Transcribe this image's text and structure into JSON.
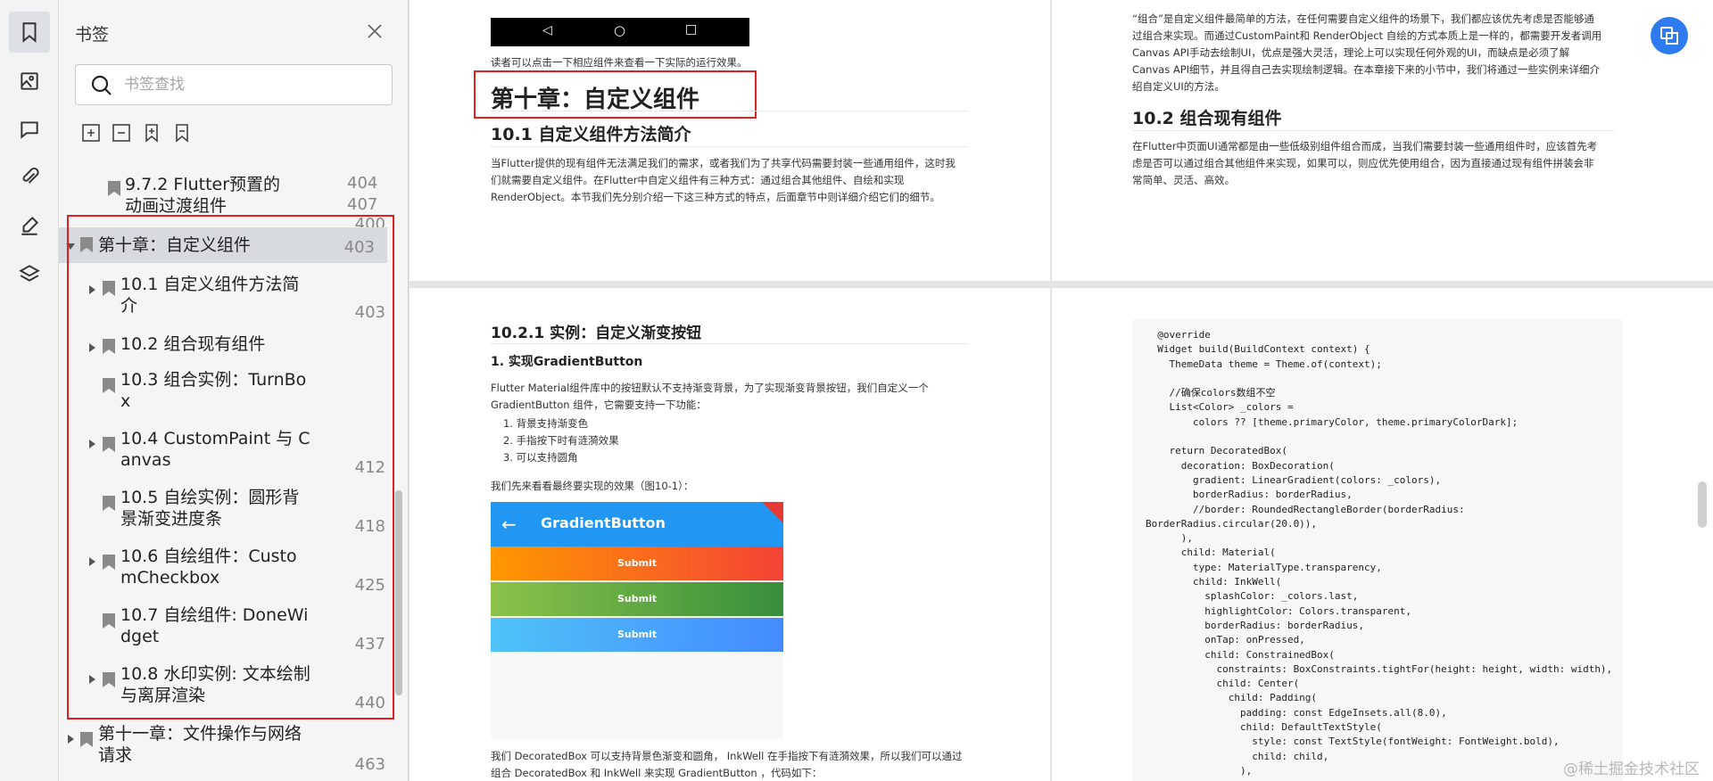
{
  "rail": {
    "icons": [
      "bookmark-icon",
      "image-icon",
      "comment-icon",
      "attachment-icon",
      "pen-icon",
      "layers-icon"
    ]
  },
  "panel": {
    "title": "书签",
    "search_placeholder": "书签查找",
    "tree": [
      {
        "label_lines": [
          "9.7.2 Flutter预置的",
          "动画过渡组件"
        ],
        "page": "400"
      },
      {
        "label_lines": [
          "第十章：自定义组件"
        ],
        "page": "403"
      },
      {
        "label_lines": [
          "10.1 自定义组件方法简",
          "介"
        ],
        "page": "403"
      },
      {
        "label_lines": [
          "10.2 组合现有组件"
        ],
        "page": "404"
      },
      {
        "label_lines": [
          "10.3 组合实例：TurnBo",
          "x"
        ],
        "page": "407"
      },
      {
        "label_lines": [
          "10.4 CustomPaint 与 C",
          "anvas"
        ],
        "page": "412"
      },
      {
        "label_lines": [
          "10.5 自绘实例：圆形背",
          "景渐变进度条"
        ],
        "page": "418"
      },
      {
        "label_lines": [
          "10.6 自绘组件：Custo",
          "mCheckbox"
        ],
        "page": "425"
      },
      {
        "label_lines": [
          "10.7 自绘组件: DoneWi",
          "dget"
        ],
        "page": "437"
      },
      {
        "label_lines": [
          "10.8 水印实例: 文本绘制",
          "与离屏渲染"
        ],
        "page": "440"
      },
      {
        "label_lines": [
          "第十一章：文件操作与网络",
          "请求"
        ],
        "page": "463"
      }
    ]
  },
  "doc": {
    "p1": {
      "caption": "读者可以点击一下相应组件来查看一下实际的运行效果。",
      "chapter_title": "第十章：自定义组件",
      "sec_title": "10.1 自定义组件方法简介",
      "para": [
        "当Flutter提供的现有组件无法满足我们的需求，或者我们为了共享代码需要封装一些通用组件，这时我",
        "们就需要自定义组件。在Flutter中自定义组件有三种方式：通过组合其他组件、自绘和实现",
        "RenderObject。本节我们先分别介绍一下这三种方式的特点，后面章节中则详细介绍它们的细节。"
      ]
    },
    "p2": {
      "para1": [
        "“组合”是自定义组件最简单的方法，在任何需要自定义组件的场景下，我们都应该优先考虑是否能够通",
        "过组合来实现。而通过CustomPaint和 RenderObject 自绘的方式本质上是一样的，都需要开发者调用",
        "Canvas API手动去绘制UI，优点是强大灵活，理论上可以实现任何外观的UI，而缺点是必须了解",
        "Canvas API细节，并且得自己去实现绘制逻辑。在本章接下来的小节中，我们将通过一些实例来详细介",
        "绍自定义UI的方法。"
      ],
      "sec_title": "10.2 组合现有组件",
      "para2": [
        "在Flutter中页面UI通常都是由一些低级别组件组合而成，当我们需要封装一些通用组件时，应该首先考",
        "虑是否可以通过组合其他组件来实现，如果可以，则应优先使用组合，因为直接通过现有组件拼装会非",
        "常简单、灵活、高效。"
      ]
    },
    "p3": {
      "sub_title": "10.2.1 实例：自定义渐变按钮",
      "item_title": "1. 实现GradientButton",
      "para": [
        "Flutter Material组件库中的按钮默认不支持渐变背景，为了实现渐变背景按钮，我们自定义一个",
        "GradientButton 组件，它需要支持一下功能："
      ],
      "list": [
        "1. 背景支持渐变色",
        "2. 手指按下时有涟漪效果",
        "3. 可以支持圆角"
      ],
      "figure_caption": "我们先来看看最终要实现的效果（图10-1）：",
      "phone_title": "GradientButton",
      "buttons": [
        "Submit",
        "Submit",
        "Submit"
      ],
      "bottom": [
        "我们 DecoratedBox 可以支持背景色渐变和圆角， InkWell 在手指按下有涟漪效果，所以我们可以通过",
        "组合 DecoratedBox 和 InkWell 来实现 GradientButton ，代码如下："
      ]
    },
    "p4": {
      "code": "  @override\n  Widget build(BuildContext context) {\n    ThemeData theme = Theme.of(context);\n\n    //确保colors数组不空\n    List<Color> _colors =\n        colors ?? [theme.primaryColor, theme.primaryColorDark];\n\n    return DecoratedBox(\n      decoration: BoxDecoration(\n        gradient: LinearGradient(colors: _colors),\n        borderRadius: borderRadius,\n        //border: RoundedRectangleBorder(borderRadius:\nBorderRadius.circular(20.0)),\n      ),\n      child: Material(\n        type: MaterialType.transparency,\n        child: InkWell(\n          splashColor: _colors.last,\n          highlightColor: Colors.transparent,\n          borderRadius: borderRadius,\n          onTap: onPressed,\n          child: ConstrainedBox(\n            constraints: BoxConstraints.tightFor(height: height, width: width),\n            child: Center(\n              child: Padding(\n                padding: const EdgeInsets.all(8.0),\n                child: DefaultTextStyle(\n                  style: const TextStyle(fontWeight: FontWeight.bold),\n                  child: child,\n                ),"
    },
    "watermark": "@稀土掘金技术社区"
  }
}
